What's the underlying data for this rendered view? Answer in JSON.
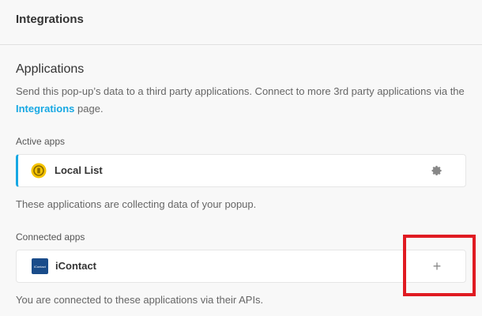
{
  "header": {
    "title": "Integrations"
  },
  "applications": {
    "title": "Applications",
    "desc_before": "Send this pop-up’s data to a third party applications. Connect to more 3rd party applications via the ",
    "desc_link": "Integrations",
    "desc_after": " page."
  },
  "active_apps": {
    "label": "Active apps",
    "items": [
      {
        "name": "Local List",
        "icon": "local-list-icon",
        "action_icon": "gear-icon"
      }
    ],
    "help": "These applications are collecting data of your popup."
  },
  "connected_apps": {
    "label": "Connected apps",
    "items": [
      {
        "name": "iContact",
        "icon": "icontact-icon",
        "icon_text": "iContact",
        "action_icon": "plus-icon",
        "action_symbol": "+"
      }
    ],
    "help": "You are connected to these applications via their APIs."
  },
  "colors": {
    "accent": "#17a8e3",
    "highlight": "#e01b22",
    "local_list_icon": "#f5c400",
    "icontact_icon": "#1a4c8a"
  }
}
